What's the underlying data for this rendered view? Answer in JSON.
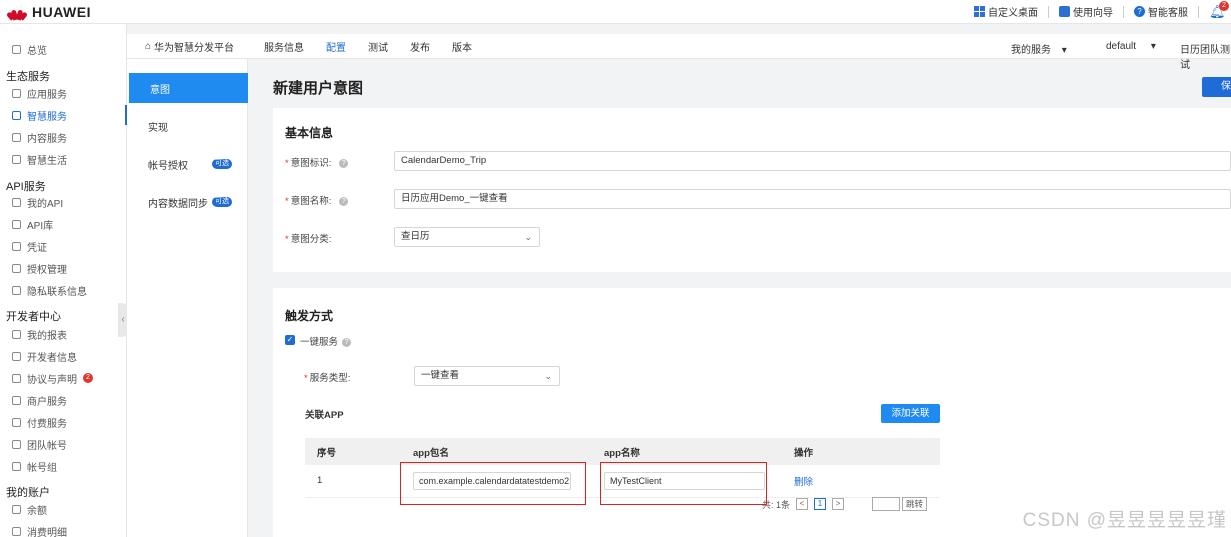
{
  "header": {
    "brand": "HUAWEI",
    "links": [
      {
        "label": "自定义桌面",
        "icon": "grid-icon"
      },
      {
        "label": "使用向导",
        "icon": "guide-icon"
      },
      {
        "label": "智能客服",
        "icon": "help-icon"
      }
    ],
    "notification_count": "2"
  },
  "sidebar": {
    "overview": "总览",
    "groups": [
      {
        "title": "生态服务",
        "items": [
          "应用服务",
          "智慧服务",
          "内容服务",
          "智慧生活"
        ]
      },
      {
        "title": "API服务",
        "items": [
          "我的API",
          "API库",
          "凭证",
          "授权管理",
          "隐私联系信息"
        ]
      },
      {
        "title": "开发者中心",
        "items": [
          "我的报表",
          "开发者信息",
          "协议与声明",
          "商户服务",
          "付费服务",
          "团队帐号",
          "帐号组"
        ]
      },
      {
        "title": "我的账户",
        "items": [
          "余额",
          "消费明细"
        ]
      }
    ],
    "active_item": "智慧服务",
    "agreement_badge": "2"
  },
  "product_bar": {
    "home": "华为智慧分发平台",
    "tabs": [
      "服务信息",
      "配置",
      "测试",
      "发布",
      "版本"
    ],
    "active_tab": "配置",
    "my_service": "我的服务",
    "env": "default",
    "team": "日历团队测试"
  },
  "subnav": {
    "items": [
      {
        "label": "意图",
        "tag": ""
      },
      {
        "label": "实现",
        "tag": ""
      },
      {
        "label": "帐号授权",
        "tag": "可选"
      },
      {
        "label": "内容数据同步",
        "tag": "可选"
      }
    ],
    "active": "意图"
  },
  "page": {
    "title": "新建用户意图",
    "save_label": "保"
  },
  "basic_info": {
    "title": "基本信息",
    "intent_id_label": "意图标识:",
    "intent_id_value": "CalendarDemo_Trip",
    "intent_name_label": "意图名称:",
    "intent_name_value": "日历应用Demo_一键查看",
    "intent_category_label": "意图分类:",
    "intent_category_value": "查日历"
  },
  "trigger": {
    "title": "触发方式",
    "one_click_label": "一键服务",
    "service_type_label": "服务类型:",
    "service_type_value": "一键查看",
    "related_app_label": "关联APP",
    "add_button": "添加关联",
    "table": {
      "headers": [
        "序号",
        "app包名",
        "app名称",
        "操作"
      ],
      "rows": [
        {
          "index": "1",
          "package": "com.example.calendardatatestdemo2",
          "name": "MyTestClient",
          "action": "删除"
        }
      ]
    },
    "pagination": {
      "total": "共: 1条",
      "prev": "<",
      "page": "1",
      "next": ">",
      "go": "跳转"
    }
  },
  "watermark": "CSDN @昱昱昱昱昱瑾",
  "colors": {
    "accent": "#1f6bd8",
    "brand_red": "#cf0a2c",
    "highlight_box": "#e02020"
  }
}
